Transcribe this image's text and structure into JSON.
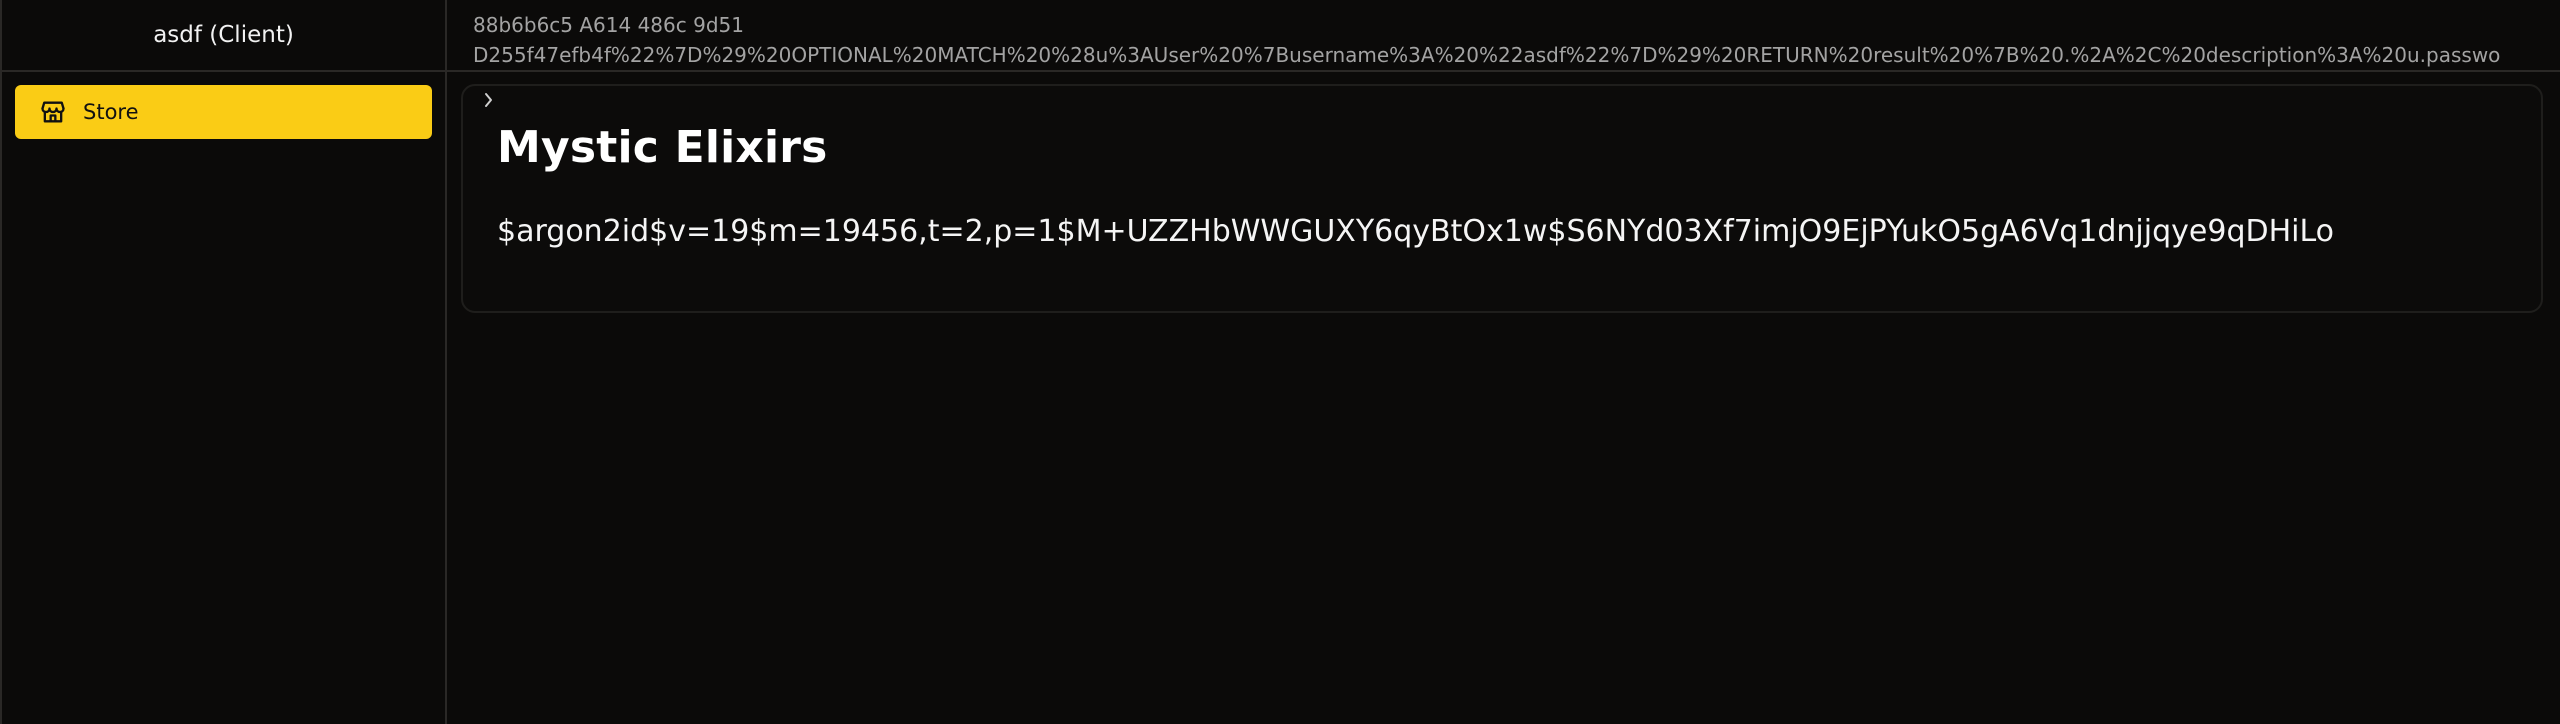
{
  "sidebar": {
    "title": "asdf (Client)",
    "items": [
      {
        "label": "Store",
        "icon": "store-icon",
        "active": true
      }
    ]
  },
  "topbar": {
    "line1": "88b6b6c5 A614 486c 9d51",
    "line2": "D255f47efb4f%22%7D%29%20OPTIONAL%20MATCH%20%28u%3AUser%20%7Busername%3A%20%22asdf%22%7D%29%20RETURN%20result%20%7B%20.%2A%2C%20description%3A%20u.passwo"
  },
  "card": {
    "title": "Mystic Elixirs",
    "description": "$argon2id$v=19$m=19456,t=2,p=1$M+UZZHbWWGUXY6qyBtOx1w$S6NYd03Xf7imjO9EjPYukO5gA6Vq1dnjjqye9qDHiLo"
  },
  "colors": {
    "accent": "#facc15",
    "background": "#0b0a09",
    "border": "#2a2826"
  }
}
